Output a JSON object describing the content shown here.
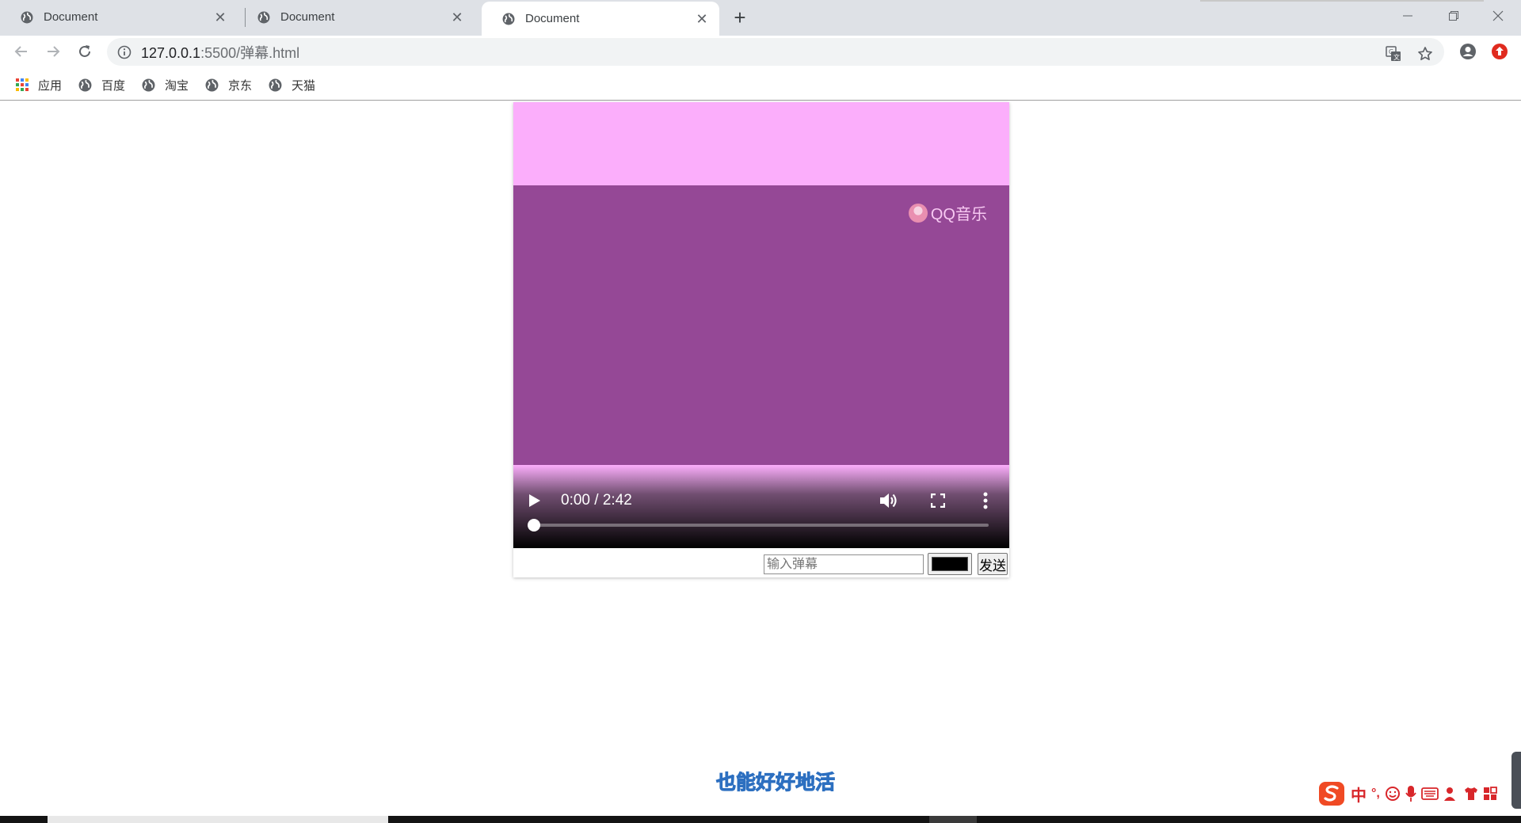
{
  "browser": {
    "tabs": [
      {
        "title": "Document",
        "active": false
      },
      {
        "title": "Document",
        "active": false
      },
      {
        "title": "Document",
        "active": true
      }
    ],
    "new_tab_label": "+",
    "url_host": "127.0.0.1",
    "url_path": ":5500/弹幕.html",
    "bookmarks": [
      {
        "label": "应用",
        "icon": "apps-grid-icon"
      },
      {
        "label": "百度",
        "icon": "globe-icon"
      },
      {
        "label": "淘宝",
        "icon": "globe-icon"
      },
      {
        "label": "京东",
        "icon": "globe-icon"
      },
      {
        "label": "天猫",
        "icon": "globe-icon"
      }
    ]
  },
  "video": {
    "watermark": "QQ音乐",
    "time_display": "0:00 / 2:42",
    "progress_fraction": 0,
    "colors": {
      "letterbox": "#fbaefb",
      "frame": "#954896"
    }
  },
  "danmu": {
    "input_placeholder": "输入弹幕",
    "input_value": "",
    "color_value": "#000000",
    "send_label": "发送"
  },
  "desktop": {
    "lyric": "也能好好地活",
    "ime_label": "中",
    "ime_punct": "°,"
  }
}
